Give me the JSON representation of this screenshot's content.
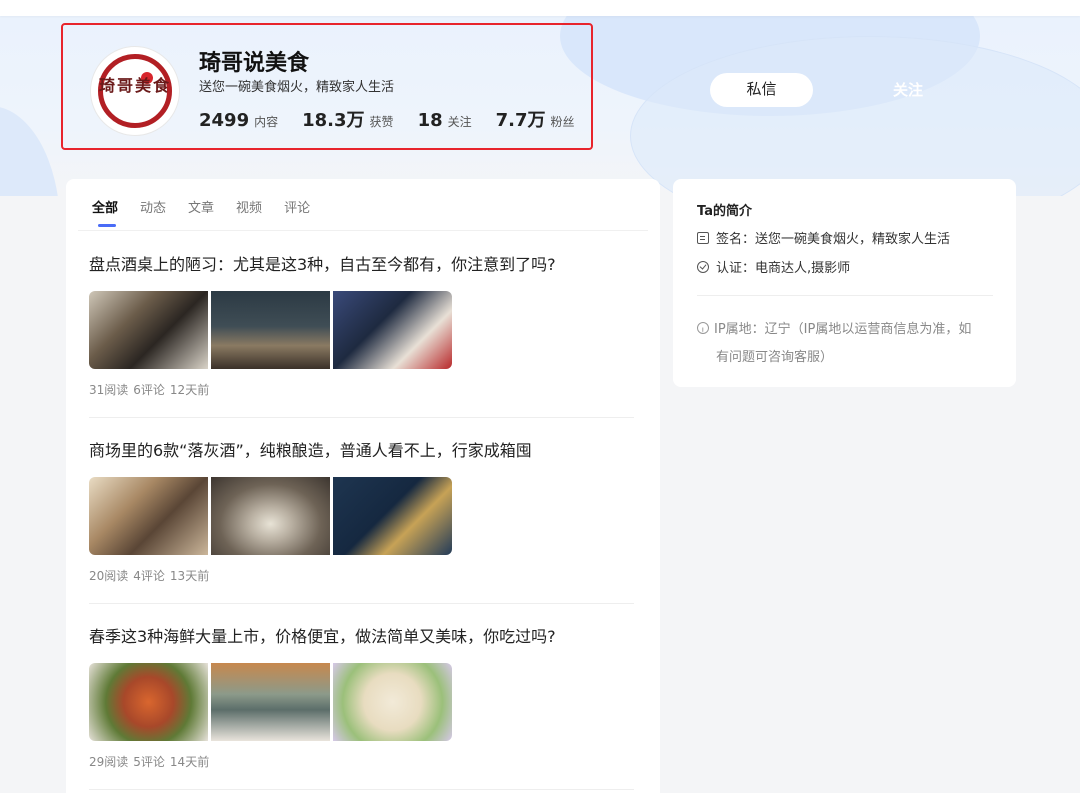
{
  "profile": {
    "name": "琦哥说美食",
    "signature": "送您一碗美食烟火，精致家人生活",
    "avatar_text": "琦哥美食",
    "stats": [
      {
        "value": "2499",
        "label": "内容"
      },
      {
        "value": "18.3万",
        "label": "获赞"
      },
      {
        "value": "18",
        "label": "关注"
      },
      {
        "value": "7.7万",
        "label": "粉丝"
      }
    ],
    "message_button": "私信",
    "follow_button": "关注"
  },
  "tabs": [
    "全部",
    "动态",
    "文章",
    "视频",
    "评论"
  ],
  "articles": [
    {
      "title": "盘点酒桌上的陋习：尤其是这3种，自古至今都有，你注意到了吗?",
      "reads": "31阅读",
      "comments": "6评论",
      "time": "12天前"
    },
    {
      "title": "商场里的6款“落灰酒”，纯粮酿造，普通人看不上，行家成箱囤",
      "reads": "20阅读",
      "comments": "4评论",
      "time": "13天前"
    },
    {
      "title": "春季这3种海鲜大量上市，价格便宜，做法简单又美味，你吃过吗?",
      "reads": "29阅读",
      "comments": "5评论",
      "time": "14天前"
    }
  ],
  "intro": {
    "title": "Ta的简介",
    "signature": "签名：送您一碗美食烟火，精致家人生活",
    "certification": "认证：电商达人,摄影师",
    "ip_line1": "IP属地：辽宁（IP属地以运营商信息为准，如",
    "ip_line2": "有问题可咨询客服）"
  },
  "colors": {
    "highlight_border": "#e8242c",
    "tab_indicator": "#4a6cf7",
    "hero_bg": "#eaf2fd"
  }
}
